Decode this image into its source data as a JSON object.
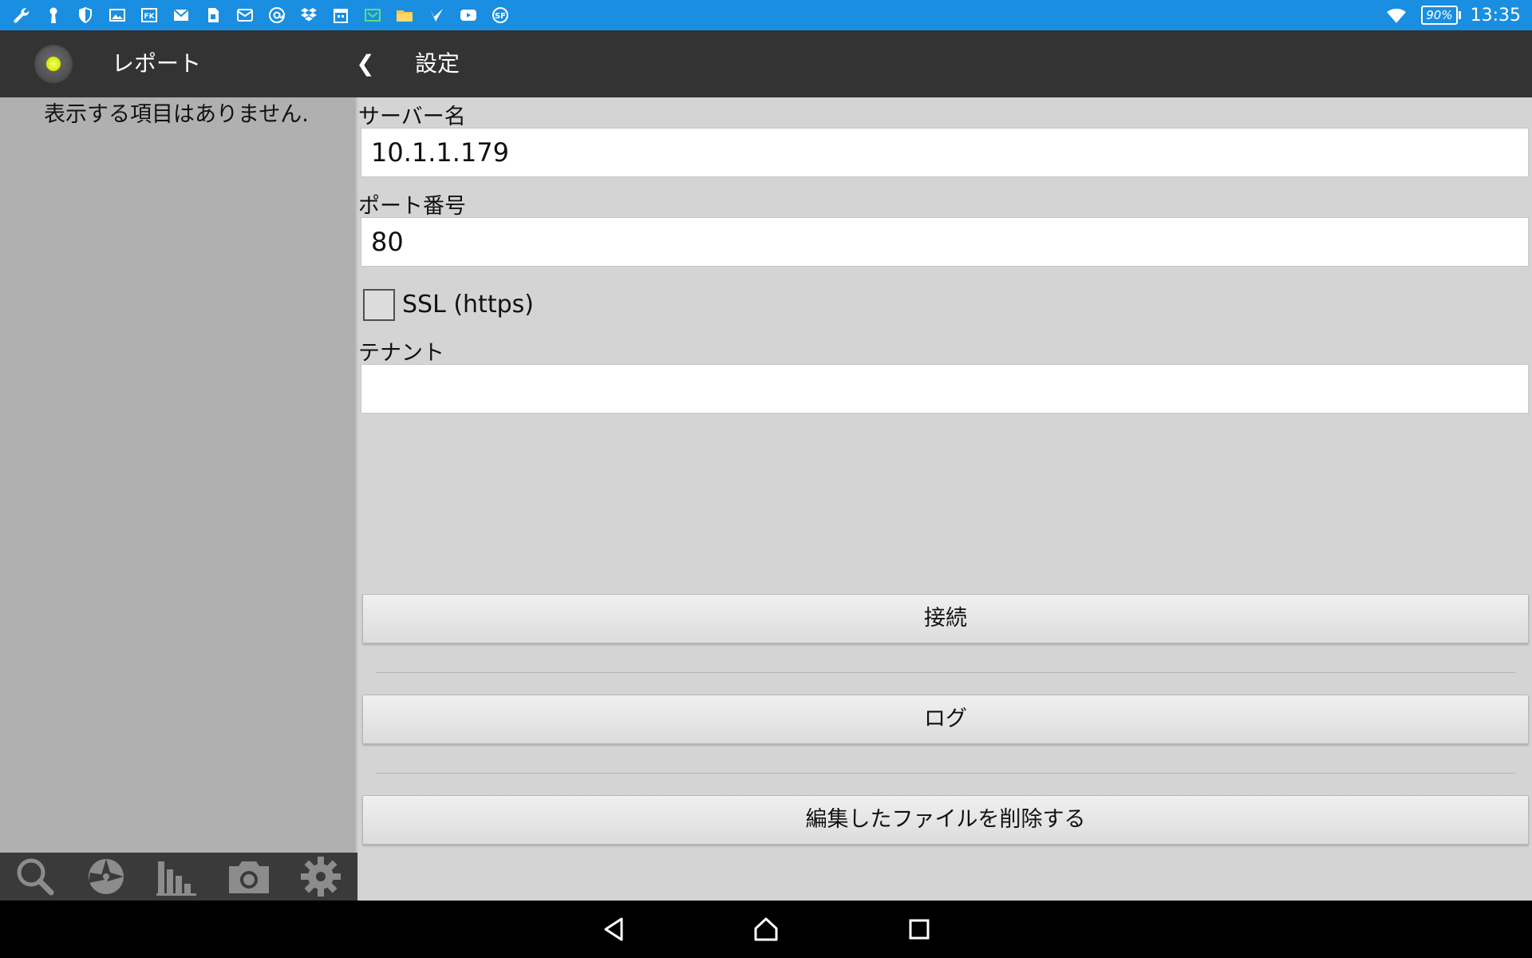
{
  "status_bar": {
    "icons": [
      "wrench-icon",
      "keyhole-icon",
      "shield-icon",
      "image-icon",
      "fk-icon",
      "mail-icon",
      "sim-icon",
      "email-icon",
      "at-icon",
      "dropbox-icon",
      "calendar-icon",
      "green-mail-icon",
      "folder-icon",
      "check-flag-icon",
      "youtube-icon",
      "sf-icon"
    ],
    "battery": "90%",
    "time": "13:35"
  },
  "left_header": {
    "title": "レポート"
  },
  "right_header": {
    "title": "設定",
    "back_glyph": "❮"
  },
  "left_pane": {
    "empty_message": "表示する項目はありません."
  },
  "form": {
    "server_label": "サーバー名",
    "server_value": "10.1.1.179",
    "port_label": "ポート番号",
    "port_value": "80",
    "ssl_label": "SSL (https)",
    "ssl_checked": false,
    "tenant_label": "テナント",
    "tenant_value": ""
  },
  "buttons": {
    "connect": "接続",
    "log": "ログ",
    "delete_edited": "編集したファイルを削除する"
  },
  "toolbar": {
    "items": [
      "search-icon",
      "compass-icon",
      "bar-chart-icon",
      "camera-icon",
      "gear-icon"
    ]
  },
  "colors": {
    "status_bar": "#1a8ee0",
    "action_bar": "#333333",
    "left_pane": "#b0b0b0",
    "right_pane": "#d4d4d4",
    "indicator": "#d7ea00"
  }
}
